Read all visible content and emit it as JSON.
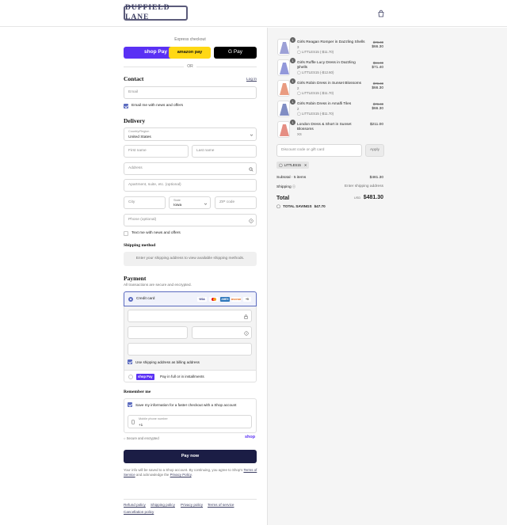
{
  "header": {
    "brand": "DUFFIELD LANE",
    "cart_icon": "shopping-bag-icon"
  },
  "express": {
    "label": "Express checkout",
    "shop_pay": "shop Pay",
    "amazon_pay": "amazon pay",
    "google_pay": "G Pay",
    "or": "OR"
  },
  "contact": {
    "title": "Contact",
    "login": "Log in",
    "email_placeholder": "Email",
    "news_label": "Email me with news and offers",
    "news_checked": true
  },
  "delivery": {
    "title": "Delivery",
    "country_label": "Country/Region",
    "country_value": "United States",
    "first_name": "First name",
    "last_name": "Last name",
    "address": "Address",
    "apartment": "Apartment, suite, etc. (optional)",
    "city": "City",
    "state_label": "State",
    "state_value": "Iowa",
    "zip": "ZIP code",
    "phone": "Phone (optional)",
    "text_label": "Text me with news and offers",
    "text_checked": false
  },
  "shipping": {
    "title": "Shipping method",
    "message": "Enter your shipping address to view available shipping methods."
  },
  "payment": {
    "title": "Payment",
    "subtitle": "All transactions are secure and encrypted.",
    "credit_card": "Credit card",
    "brands": [
      "VISA",
      "MC",
      "AMEX",
      "DISCOVER"
    ],
    "more": "+5",
    "billing_label": "Use shipping address as billing address",
    "billing_checked": true,
    "shop_pay_label": "shop Pay",
    "shop_pay_text": "Pay in full or in installments"
  },
  "remember": {
    "title": "Remember me",
    "save_label": "Save my information for a faster checkout with a Shop account",
    "save_checked": true,
    "phone_label": "Mobile phone number",
    "phone_value": "+1",
    "secure": "Secure and encrypted",
    "shop_logo": "shop"
  },
  "pay_now": "Pay now",
  "terms": {
    "text1": "Your info will be saved to a Shop account. By continuing, you agree to Shop's",
    "terms_link": "Terms of Service",
    "text2": "and acknowledge the",
    "privacy_link": "Privacy Policy",
    "text3": "."
  },
  "footer_links": [
    "Refund policy",
    "Shipping policy",
    "Privacy policy",
    "Terms of service",
    "Cancellation policy"
  ],
  "cart": {
    "items": [
      {
        "name": "Girls Reagan Romper in Dazzling Shells",
        "variant": "3",
        "discount": "LITTLES15 (-$11.70)",
        "original": "$78.00",
        "price": "$66.30",
        "qty": "1",
        "color": "#8b8fcf"
      },
      {
        "name": "Girls Ruffle Lucy Dress in Dazzling Shells",
        "variant": "2",
        "discount": "LITTLES15 (-$12.60)",
        "original": "$84.00",
        "price": "$71.40",
        "qty": "1",
        "color": "#7f86d3"
      },
      {
        "name": "Girls Robin Dress in Sunset Blossoms",
        "variant": "2",
        "discount": "LITTLES15 (-$11.70)",
        "original": "$78.00",
        "price": "$66.30",
        "qty": "1",
        "color": "#e58a6a"
      },
      {
        "name": "Girls Robin Dress in Amalfi Tiles",
        "variant": "2",
        "discount": "LITTLES15 (-$11.70)",
        "original": "$78.00",
        "price": "$66.30",
        "qty": "1",
        "color": "#6a79b8"
      },
      {
        "name": "London Dress & Short in Sunset Blossoms",
        "variant": "XS",
        "discount": "",
        "original": "",
        "price": "$211.00",
        "qty": "1",
        "color": "#e07a6d"
      }
    ],
    "discount_placeholder": "Discount code or gift card",
    "apply": "Apply",
    "applied_code": "LITTLES15",
    "subtotal_label": "Subtotal · 5 items",
    "subtotal_value": "$481.30",
    "shipping_label": "Shipping",
    "shipping_value": "Enter shipping address",
    "total_label": "Total",
    "currency": "USD",
    "total_value": "$481.30",
    "savings_label": "TOTAL SAVINGS",
    "savings_value": "$47.70"
  }
}
